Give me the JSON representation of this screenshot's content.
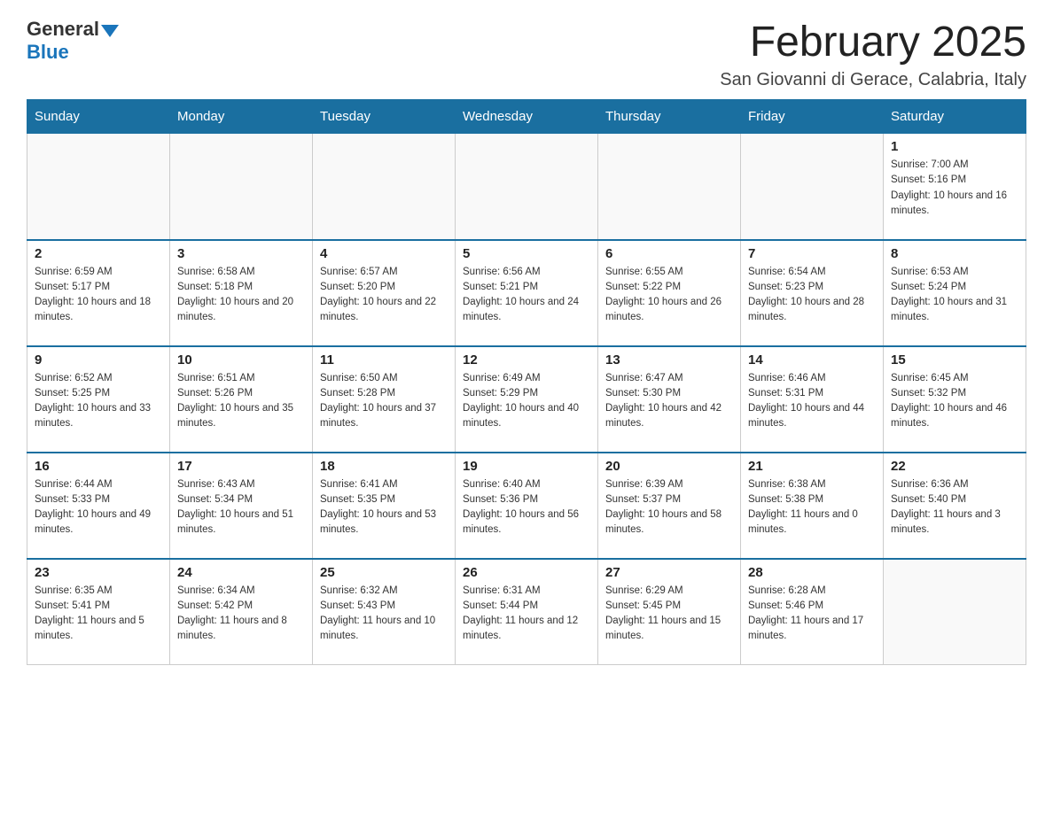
{
  "header": {
    "logo": {
      "general": "General",
      "blue": "Blue"
    },
    "title": "February 2025",
    "location": "San Giovanni di Gerace, Calabria, Italy"
  },
  "weekdays": [
    "Sunday",
    "Monday",
    "Tuesday",
    "Wednesday",
    "Thursday",
    "Friday",
    "Saturday"
  ],
  "weeks": [
    [
      {
        "day": "",
        "info": ""
      },
      {
        "day": "",
        "info": ""
      },
      {
        "day": "",
        "info": ""
      },
      {
        "day": "",
        "info": ""
      },
      {
        "day": "",
        "info": ""
      },
      {
        "day": "",
        "info": ""
      },
      {
        "day": "1",
        "info": "Sunrise: 7:00 AM\nSunset: 5:16 PM\nDaylight: 10 hours and 16 minutes."
      }
    ],
    [
      {
        "day": "2",
        "info": "Sunrise: 6:59 AM\nSunset: 5:17 PM\nDaylight: 10 hours and 18 minutes."
      },
      {
        "day": "3",
        "info": "Sunrise: 6:58 AM\nSunset: 5:18 PM\nDaylight: 10 hours and 20 minutes."
      },
      {
        "day": "4",
        "info": "Sunrise: 6:57 AM\nSunset: 5:20 PM\nDaylight: 10 hours and 22 minutes."
      },
      {
        "day": "5",
        "info": "Sunrise: 6:56 AM\nSunset: 5:21 PM\nDaylight: 10 hours and 24 minutes."
      },
      {
        "day": "6",
        "info": "Sunrise: 6:55 AM\nSunset: 5:22 PM\nDaylight: 10 hours and 26 minutes."
      },
      {
        "day": "7",
        "info": "Sunrise: 6:54 AM\nSunset: 5:23 PM\nDaylight: 10 hours and 28 minutes."
      },
      {
        "day": "8",
        "info": "Sunrise: 6:53 AM\nSunset: 5:24 PM\nDaylight: 10 hours and 31 minutes."
      }
    ],
    [
      {
        "day": "9",
        "info": "Sunrise: 6:52 AM\nSunset: 5:25 PM\nDaylight: 10 hours and 33 minutes."
      },
      {
        "day": "10",
        "info": "Sunrise: 6:51 AM\nSunset: 5:26 PM\nDaylight: 10 hours and 35 minutes."
      },
      {
        "day": "11",
        "info": "Sunrise: 6:50 AM\nSunset: 5:28 PM\nDaylight: 10 hours and 37 minutes."
      },
      {
        "day": "12",
        "info": "Sunrise: 6:49 AM\nSunset: 5:29 PM\nDaylight: 10 hours and 40 minutes."
      },
      {
        "day": "13",
        "info": "Sunrise: 6:47 AM\nSunset: 5:30 PM\nDaylight: 10 hours and 42 minutes."
      },
      {
        "day": "14",
        "info": "Sunrise: 6:46 AM\nSunset: 5:31 PM\nDaylight: 10 hours and 44 minutes."
      },
      {
        "day": "15",
        "info": "Sunrise: 6:45 AM\nSunset: 5:32 PM\nDaylight: 10 hours and 46 minutes."
      }
    ],
    [
      {
        "day": "16",
        "info": "Sunrise: 6:44 AM\nSunset: 5:33 PM\nDaylight: 10 hours and 49 minutes."
      },
      {
        "day": "17",
        "info": "Sunrise: 6:43 AM\nSunset: 5:34 PM\nDaylight: 10 hours and 51 minutes."
      },
      {
        "day": "18",
        "info": "Sunrise: 6:41 AM\nSunset: 5:35 PM\nDaylight: 10 hours and 53 minutes."
      },
      {
        "day": "19",
        "info": "Sunrise: 6:40 AM\nSunset: 5:36 PM\nDaylight: 10 hours and 56 minutes."
      },
      {
        "day": "20",
        "info": "Sunrise: 6:39 AM\nSunset: 5:37 PM\nDaylight: 10 hours and 58 minutes."
      },
      {
        "day": "21",
        "info": "Sunrise: 6:38 AM\nSunset: 5:38 PM\nDaylight: 11 hours and 0 minutes."
      },
      {
        "day": "22",
        "info": "Sunrise: 6:36 AM\nSunset: 5:40 PM\nDaylight: 11 hours and 3 minutes."
      }
    ],
    [
      {
        "day": "23",
        "info": "Sunrise: 6:35 AM\nSunset: 5:41 PM\nDaylight: 11 hours and 5 minutes."
      },
      {
        "day": "24",
        "info": "Sunrise: 6:34 AM\nSunset: 5:42 PM\nDaylight: 11 hours and 8 minutes."
      },
      {
        "day": "25",
        "info": "Sunrise: 6:32 AM\nSunset: 5:43 PM\nDaylight: 11 hours and 10 minutes."
      },
      {
        "day": "26",
        "info": "Sunrise: 6:31 AM\nSunset: 5:44 PM\nDaylight: 11 hours and 12 minutes."
      },
      {
        "day": "27",
        "info": "Sunrise: 6:29 AM\nSunset: 5:45 PM\nDaylight: 11 hours and 15 minutes."
      },
      {
        "day": "28",
        "info": "Sunrise: 6:28 AM\nSunset: 5:46 PM\nDaylight: 11 hours and 17 minutes."
      },
      {
        "day": "",
        "info": ""
      }
    ]
  ]
}
